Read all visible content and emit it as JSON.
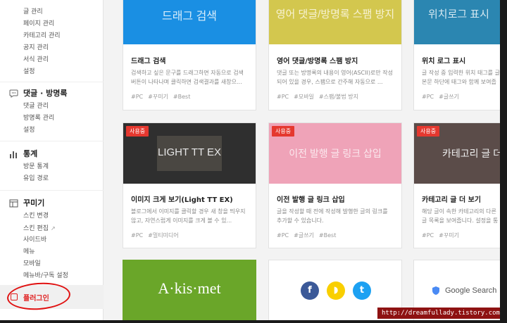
{
  "sidebar": {
    "top_items": [
      "글 관리",
      "페이지 관리",
      "카테고리 관리",
      "공지 관리",
      "서식 관리",
      "설정"
    ],
    "comments": {
      "title": "댓글 · 방명록",
      "items": [
        "댓글 관리",
        "방명록 관리",
        "설정"
      ]
    },
    "stats": {
      "title": "통계",
      "items": [
        "방문 통계",
        "유입 경로"
      ]
    },
    "decor": {
      "title": "꾸미기",
      "items": [
        "스킨 변경",
        "스킨 편집",
        "사이드바",
        "메뉴",
        "모바일",
        "메뉴바/구독 설정"
      ]
    },
    "plugin": "플러그인"
  },
  "cards": [
    {
      "thumb_text": "드래그 검색",
      "title": "드래그 검색",
      "desc": "검색하고 싶은 문구를 드래그하면 자동으로 검색 버튼이 나타나며 클릭하면 검색결과를 새창으...",
      "tags": [
        "#PC",
        "#꾸미기",
        "#Best"
      ]
    },
    {
      "thumb_text": "영어 댓글/방명록 스팸 방지",
      "title": "영어 댓글/방명록 스팸 방지",
      "desc": "댓글 또는 방명록의 내용이 영어(ASCII)로만 작성되어 있을 경우, 스팸으로 간주해 자동으로 ...",
      "tags": [
        "#PC",
        "#모바일",
        "#스팸/불법 방지"
      ]
    },
    {
      "thumb_text": "위치로그 표시",
      "title": "위치 로그 표시",
      "desc": "글 작성 중 입력한 위치 태그를 글 본문 하단에 태그와 함께 보여줍니다.",
      "tags": [
        "#PC",
        "#글쓰기"
      ]
    },
    {
      "badge": "사용중",
      "thumb_text": "LIGHT TT EX",
      "title": "이미지 크게 보기(Light TT EX)",
      "desc": "블로그에서 이미지를 클릭할 경우 새 창을 띄우지 않고, 자연스럽게 이미지를 크게 볼 수 있...",
      "tags": [
        "#PC",
        "#멀티미디어"
      ]
    },
    {
      "badge": "사용중",
      "thumb_text": "이전 발행 글 링크 삽입",
      "title": "이전 발행 글 링크 삽입",
      "desc": "글을 작성할 때 전에 작성해 발행한 글의 링크를 추가할 수 있습니다.",
      "tags": [
        "#PC",
        "#글쓰기",
        "#Best"
      ]
    },
    {
      "badge": "사용중",
      "thumb_text": "카테고리 글 더보기",
      "title": "카테고리 글 더 보기",
      "desc": "해당 글이 속한 카테고리의 다른 글 목록을 보여줍니다. 설정을 통해 스타일과 목록 ...",
      "tags": [
        "#PC",
        "#꾸미기"
      ]
    },
    {
      "thumb_text": "A·kis·met"
    },
    {
      "social": [
        "f",
        "◗",
        "t"
      ]
    },
    {
      "thumb_text": "Google Search"
    }
  ],
  "colors": {
    "blue": "#1a8fe3",
    "olive": "#d3c74e",
    "teal": "#2b86b1",
    "dark": "#2f2f2f",
    "pink": "#efa3b8",
    "brown": "#5b4c49",
    "green": "#6aa629",
    "badge": "#e5382f"
  },
  "icons": {
    "comments": "speech-bubble-icon",
    "stats": "bar-chart-icon",
    "decor": "layout-icon",
    "plugin": "plugin-icon",
    "external": "external-link-icon"
  },
  "watermark": "http://dreamfullady.tistory.com"
}
